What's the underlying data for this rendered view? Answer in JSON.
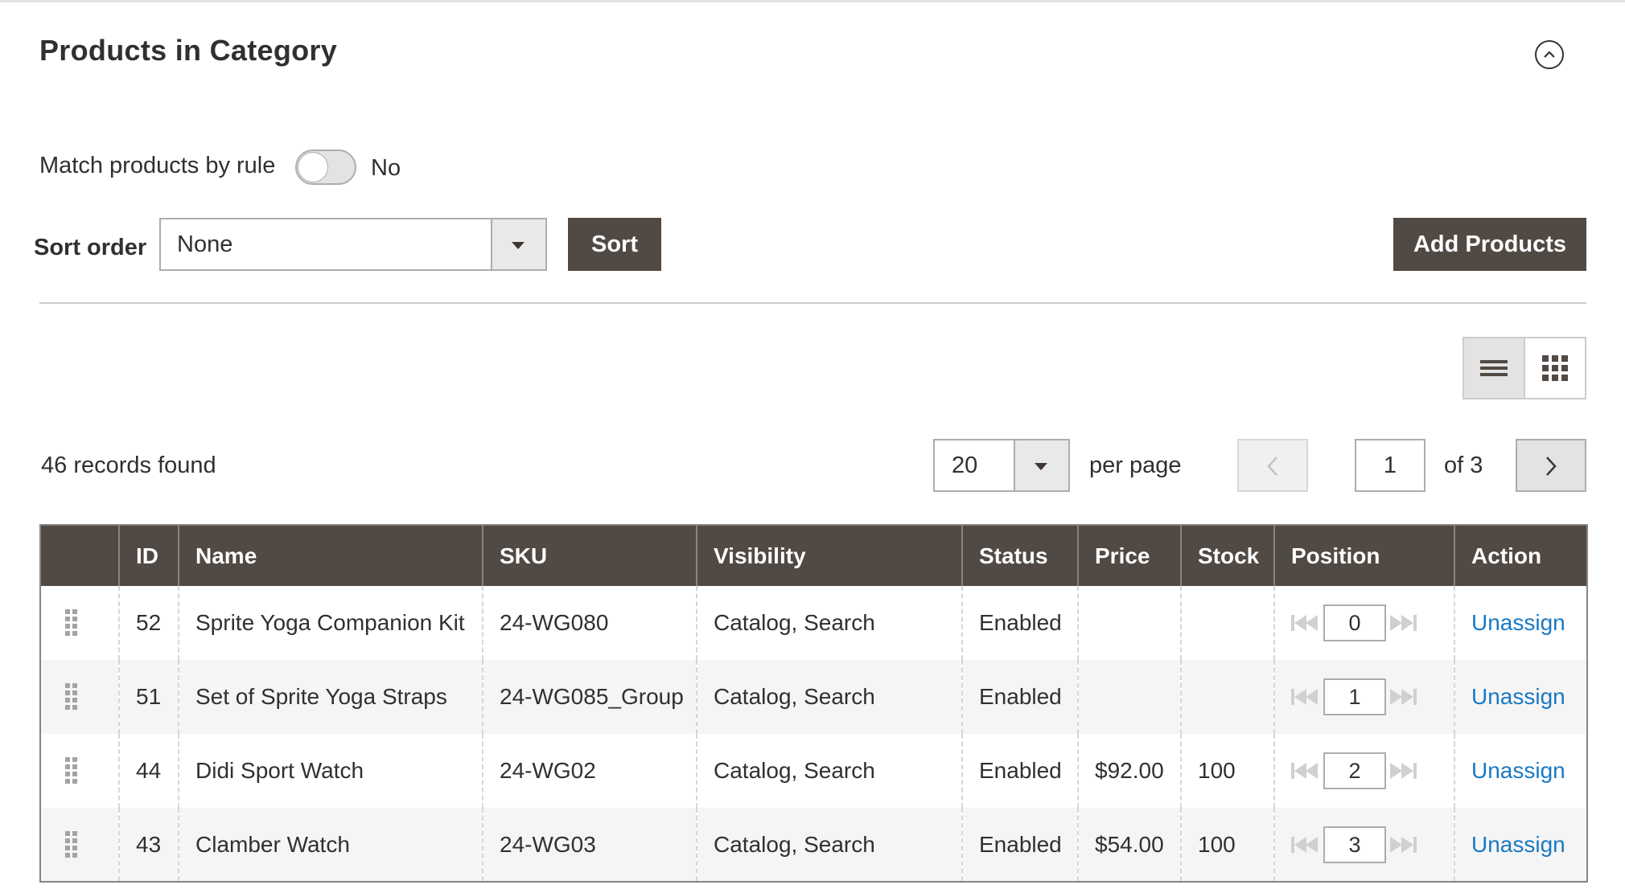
{
  "section": {
    "title": "Products in Category"
  },
  "rule": {
    "label": "Match products by rule",
    "state": "No"
  },
  "sort": {
    "label": "Sort order",
    "selected": "None",
    "button": "Sort"
  },
  "add_products_label": "Add Products",
  "records_found": "46 records found",
  "pagination": {
    "per_page_value": "20",
    "per_page_label": "per page",
    "current_page": "1",
    "of_label": "of 3"
  },
  "table": {
    "columns": [
      "",
      "ID",
      "Name",
      "SKU",
      "Visibility",
      "Status",
      "Price",
      "Stock",
      "Position",
      "Action"
    ],
    "rows": [
      {
        "id": "52",
        "name": "Sprite Yoga Companion Kit",
        "sku": "24-WG080",
        "visibility": "Catalog, Search",
        "status": "Enabled",
        "price": "",
        "stock": "",
        "position": "0",
        "action": "Unassign"
      },
      {
        "id": "51",
        "name": "Set of Sprite Yoga Straps",
        "sku": "24-WG085_Group",
        "visibility": "Catalog, Search",
        "status": "Enabled",
        "price": "",
        "stock": "",
        "position": "1",
        "action": "Unassign"
      },
      {
        "id": "44",
        "name": "Didi Sport Watch",
        "sku": "24-WG02",
        "visibility": "Catalog, Search",
        "status": "Enabled",
        "price": "$92.00",
        "stock": "100",
        "position": "2",
        "action": "Unassign"
      },
      {
        "id": "43",
        "name": "Clamber Watch",
        "sku": "24-WG03",
        "visibility": "Catalog, Search",
        "status": "Enabled",
        "price": "$54.00",
        "stock": "100",
        "position": "3",
        "action": "Unassign"
      }
    ]
  },
  "colors": {
    "dark_button": "#514943",
    "link": "#1979c3",
    "header_bg": "#514943"
  },
  "icons": {
    "collapse": "chevron-up-circle-icon",
    "list_view": "list-view-icon",
    "grid_view": "grid-view-icon",
    "drag": "drag-handle-icon",
    "first": "move-to-top-icon",
    "last": "move-to-bottom-icon"
  }
}
